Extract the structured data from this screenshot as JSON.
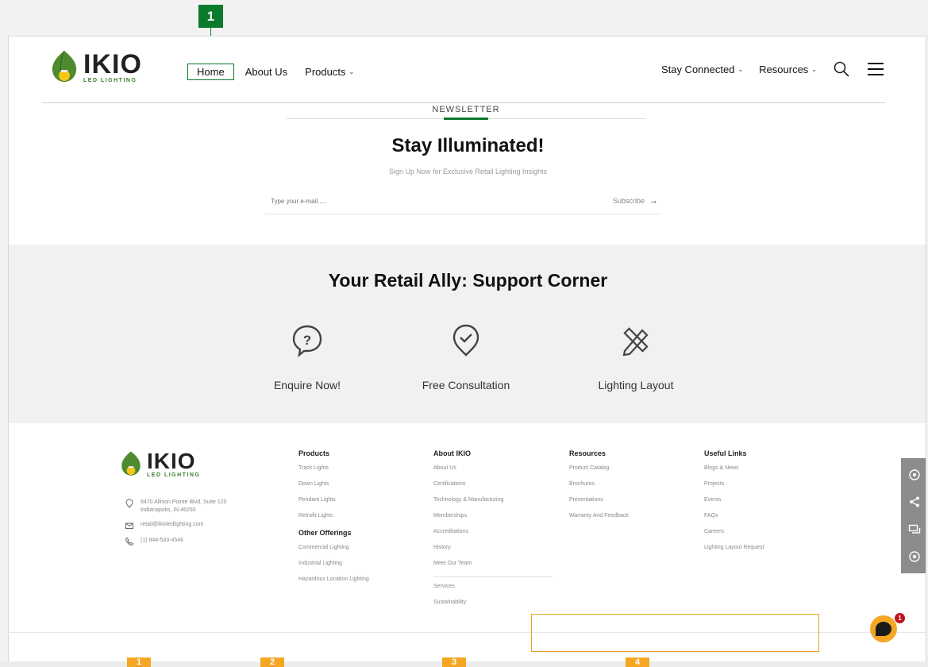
{
  "annotation": {
    "marker_1": "1",
    "bottom_markers": [
      "1",
      "2",
      "3",
      "4"
    ]
  },
  "header": {
    "logo": {
      "word": "IKIO",
      "sub": "LED LIGHTING"
    },
    "nav_left": [
      {
        "label": "Home"
      },
      {
        "label": "About Us"
      },
      {
        "label": "Products"
      }
    ],
    "nav_right": [
      {
        "label": "Stay Connected"
      },
      {
        "label": "Resources"
      }
    ]
  },
  "newsletter": {
    "kicker": "NEWSLETTER",
    "title": "Stay Illuminated!",
    "subtitle": "Sign Up Now for Exclusive Retail Lighting Insights",
    "email_placeholder": "Type your e-mail.....",
    "subscribe_label": "Subscribe"
  },
  "support": {
    "title": "Your Retail Ally: Support Corner",
    "items": [
      {
        "label": "Enquire Now!",
        "icon": "question-icon"
      },
      {
        "label": "Free Consultation",
        "icon": "location-check-icon"
      },
      {
        "label": "Lighting Layout",
        "icon": "ruler-pencil-icon"
      }
    ]
  },
  "footer": {
    "logo": {
      "word": "IKIO",
      "sub": "LED LIGHTING"
    },
    "contact": {
      "address_line1": "8470 Allison Pointe Blvd, Suite 120",
      "address_line2": "Indianapolis, IN 46250",
      "email": "retail@ikioledlighting.com",
      "phone": "(1) 844-533-4546"
    },
    "products": {
      "heading": "Products",
      "links": [
        "Track Lights",
        "Down Lights",
        "Pendant Lights",
        "Retrofit Lights"
      ],
      "other_heading": "Other Offerings",
      "other_links": [
        "Commercial Lighting",
        "Industrial Lighting",
        "Hazardous Location Lighting"
      ]
    },
    "about": {
      "heading": "About IKIO",
      "links": [
        "About Us",
        "Certifications",
        "Technology & Manufacturing",
        "Memberships",
        "Accreditations",
        "History",
        "Meet Our Team"
      ],
      "extra_links": [
        "Services",
        "Sustainability"
      ]
    },
    "resources": {
      "heading": "Resources",
      "links": [
        "Product Catalog",
        "Brochures",
        "Presentations",
        "Warranty And Feedback"
      ]
    },
    "useful": {
      "heading": "Useful Links",
      "links": [
        "Blogs & News",
        "Projects",
        "Events",
        "FAQs",
        "Careers",
        "Lighting Layout Request"
      ]
    }
  },
  "chat": {
    "badge": "1"
  },
  "colors": {
    "brand_green": "#0a7a2c",
    "accent_orange": "#f5a623",
    "highlight_border": "#e8a317"
  }
}
